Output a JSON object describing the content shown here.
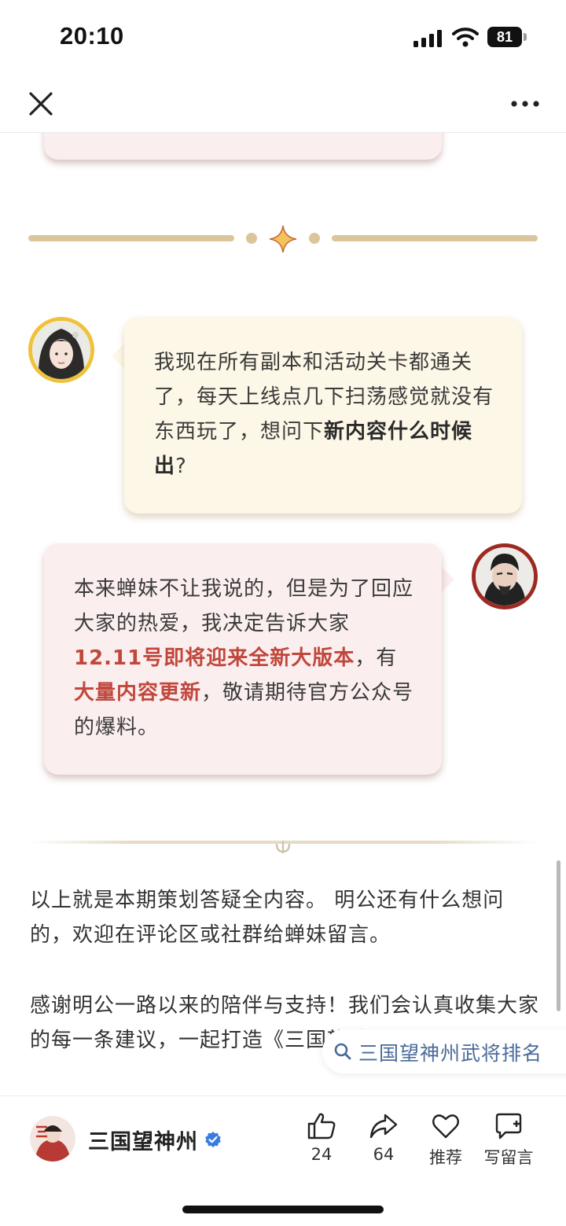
{
  "status_bar": {
    "time": "20:10",
    "battery": "81"
  },
  "article": {
    "question": {
      "text_1": "我现在所有副本和活动关卡都通关了，每天上线点几下扫荡感觉就没有东西玩了，想问下",
      "bold": "新内容什么时候出",
      "text_2": "?"
    },
    "answer": {
      "text_1": "本来蝉妹不让我说的，但是为了回应大家的热爱，我决定告诉大家",
      "red_1": "12.11号即将迎来全新大版本",
      "text_2": "，有",
      "red_2": "大量内容更新",
      "text_3": "，敬请期待官方公众号的爆料。"
    },
    "paragraph_1": "以上就是本期策划答疑全内容。 明公还有什么想问的，欢迎在评论区或社群给蝉妹留言。",
    "paragraph_2": "感谢明公一路以来的陪伴与支持！我们会认真收集大家的每一条建议，一起打造《三国望神州》！"
  },
  "search_chip": {
    "label": "三国望神州武将排名"
  },
  "bottom_bar": {
    "account_name": "三国望神州",
    "like_count": "24",
    "share_count": "64",
    "recommend_label": "推荐",
    "comment_label": "写留言"
  },
  "colors": {
    "accent_red": "#c0473c",
    "divider_gold": "#ddc59b",
    "question_bg": "#fdf7e7",
    "answer_bg": "#fbeeee",
    "link_blue": "#4a6a9a",
    "verified_blue": "#3a7be0"
  },
  "icons": [
    "close-icon",
    "more-icon",
    "sparkle-icon",
    "search-icon",
    "like-icon",
    "share-icon",
    "heart-icon",
    "comment-icon",
    "verified-icon"
  ]
}
